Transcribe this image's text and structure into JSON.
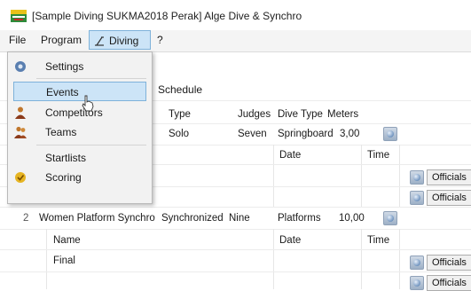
{
  "window": {
    "title": "[Sample Diving SUKMA2018 Perak] Alge Dive & Synchro"
  },
  "menubar": {
    "file": "File",
    "program": "Program",
    "diving": "Diving",
    "help": "?"
  },
  "diving_menu": {
    "settings": "Settings",
    "events": "Events",
    "competitors": "Competitors",
    "teams": "Teams",
    "startlists": "Startlists",
    "scoring": "Scoring"
  },
  "tab": {
    "schedule": "Schedule"
  },
  "event_header": {
    "type": "Type",
    "judges": "Judges",
    "dive_type": "Dive Type",
    "meters": "Meters"
  },
  "events": [
    {
      "number": "",
      "name": "",
      "type": "Solo",
      "judges": "Seven",
      "dive_type": "Springboard",
      "meters": "3,00"
    },
    {
      "number": "2",
      "name": "Women Platform Synchro",
      "type": "Synchronized",
      "judges": "Nine",
      "dive_type": "Platforms",
      "meters": "10,00"
    }
  ],
  "round_header": {
    "name": "Name",
    "date": "Date",
    "time": "Time"
  },
  "rounds": [
    {
      "name": "Final"
    }
  ],
  "buttons": {
    "officials": "Officials"
  },
  "colors": {
    "highlight": "#cce4f7",
    "highlight_border": "#7fb2da"
  }
}
